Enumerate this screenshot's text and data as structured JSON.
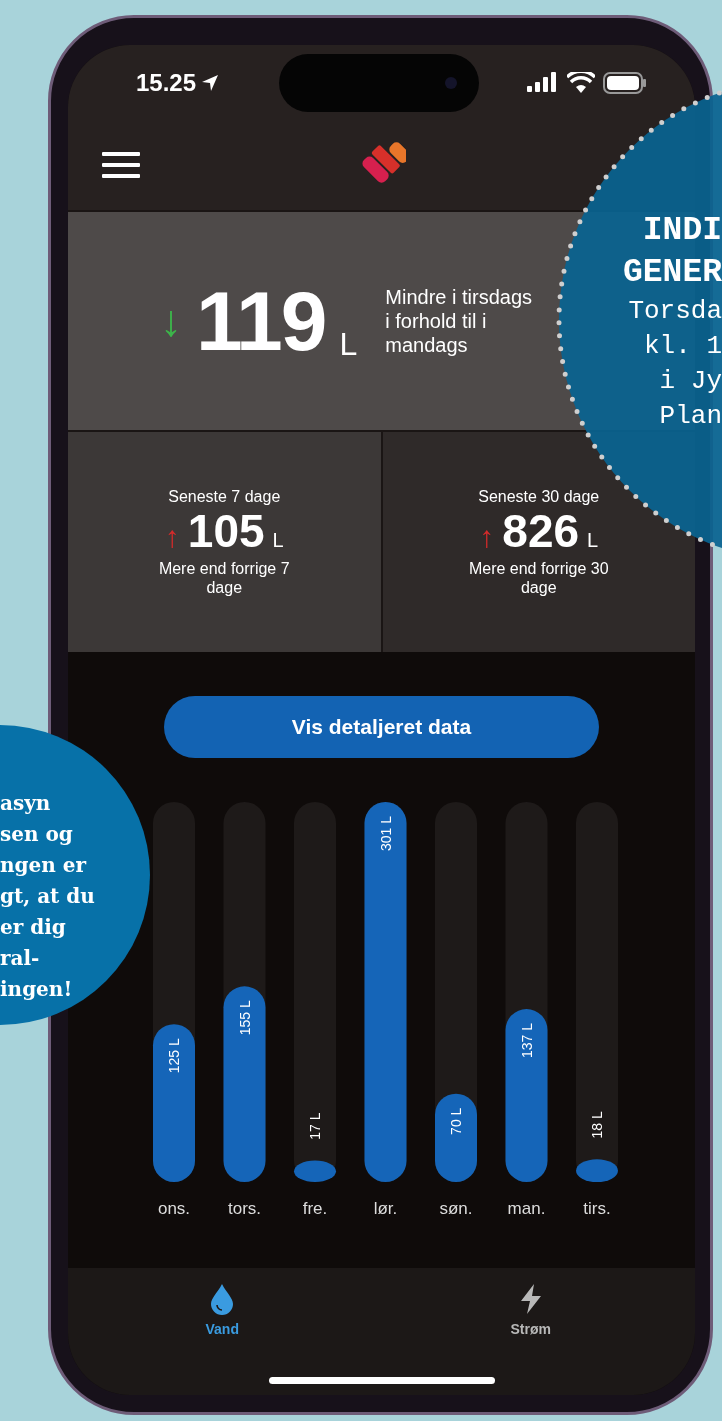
{
  "status_bar": {
    "time": "15.25"
  },
  "summary": {
    "arrow": "↓",
    "kind": "down",
    "value": "119",
    "unit": "L",
    "text": "Mindre i tirsdags i forhold til i mandags"
  },
  "tiles": [
    {
      "title": "Seneste 7 dage",
      "arrow": "↑",
      "kind": "up",
      "value": "105",
      "unit": "L",
      "text": "Mere end forrige 7 dage"
    },
    {
      "title": "Seneste 30 dage",
      "arrow": "↑",
      "kind": "up",
      "value": "826",
      "unit": "L",
      "text": "Mere end forrige 30 dage"
    }
  ],
  "detail_button": "Vis detaljeret data",
  "chart": {
    "chart_data": {
      "type": "bar",
      "categories": [
        "ons.",
        "tors.",
        "fre.",
        "lør.",
        "søn.",
        "man.",
        "tirs."
      ],
      "values": [
        125,
        155,
        17,
        301,
        70,
        137,
        18
      ],
      "value_labels": [
        "125 L",
        "155 L",
        "17 L",
        "301 L",
        "70 L",
        "137 L",
        "18 L"
      ]
    }
  },
  "bottom_nav": [
    {
      "label": "Vand",
      "kind": "water",
      "selected": true
    },
    {
      "label": "Strøm",
      "kind": "power",
      "selected": false
    }
  ],
  "overlays": [
    {
      "kind": "right",
      "lines": [
        "INDI",
        "GENER",
        "Torsda",
        "kl. 1",
        "i Jy",
        "Plan"
      ]
    },
    {
      "kind": "left",
      "lines": [
        "asyn",
        "sen og",
        "ngen er",
        "gt, at du",
        "er dig",
        "ral-",
        "ingen!"
      ]
    }
  ]
}
